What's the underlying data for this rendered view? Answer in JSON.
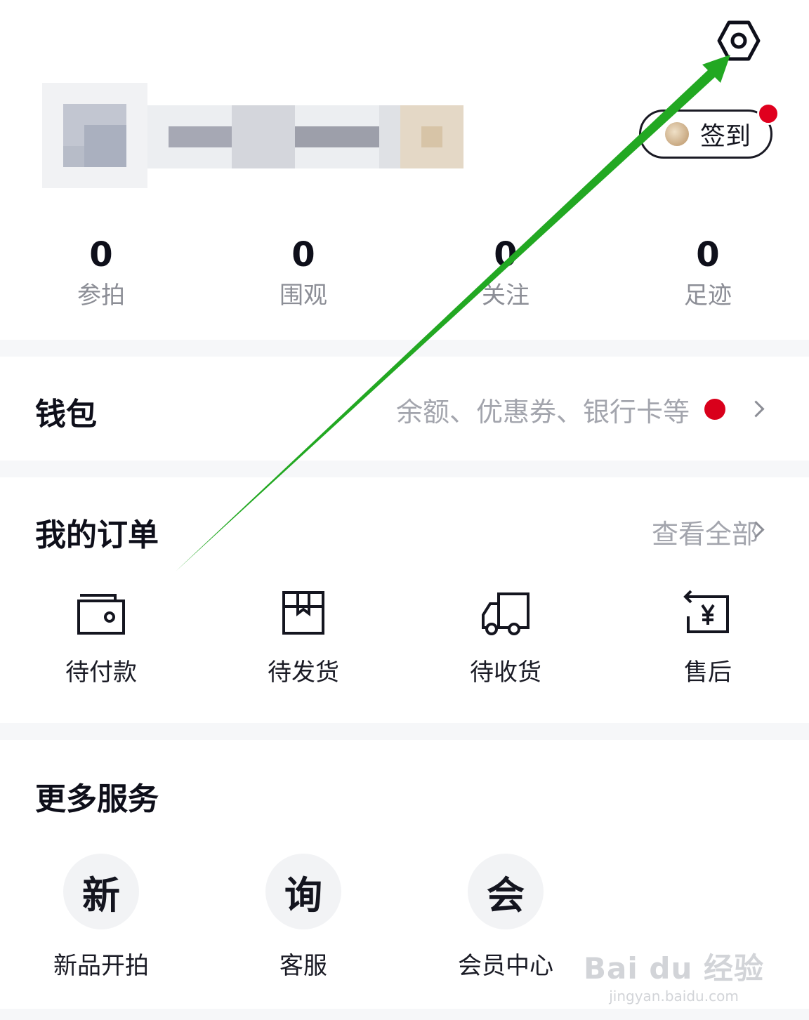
{
  "header": {
    "settings_icon": "hexagon-settings-icon",
    "checkin": {
      "label": "签到",
      "icon": "bean-icon",
      "has_notification": true
    }
  },
  "profile": {
    "avatar": "blurred",
    "username": "blurred"
  },
  "stats": [
    {
      "value": "0",
      "label": "参拍"
    },
    {
      "value": "0",
      "label": "围观"
    },
    {
      "value": "0",
      "label": "关注"
    },
    {
      "value": "0",
      "label": "足迹"
    }
  ],
  "wallet": {
    "title": "钱包",
    "hint": "余额、优惠券、银行卡等",
    "has_notification": true
  },
  "orders": {
    "title": "我的订单",
    "see_all": "查看全部",
    "items": [
      {
        "label": "待付款",
        "icon": "wallet-icon"
      },
      {
        "label": "待发货",
        "icon": "box-icon"
      },
      {
        "label": "待收货",
        "icon": "truck-icon"
      },
      {
        "label": "售后",
        "icon": "refund-yen-icon"
      }
    ]
  },
  "services": {
    "title": "更多服务",
    "items": [
      {
        "glyph": "新",
        "label": "新品开拍"
      },
      {
        "glyph": "询",
        "label": "客服"
      },
      {
        "glyph": "会",
        "label": "会员中心"
      }
    ]
  },
  "annotation": {
    "arrow_color": "#22a822"
  },
  "watermark": {
    "logo": "Bai du 经验",
    "url": "jingyan.baidu.com"
  },
  "colors": {
    "notification_red": "#e0001e",
    "section_gap": "#f6f7f9",
    "muted_text": "#a3a5ad"
  }
}
